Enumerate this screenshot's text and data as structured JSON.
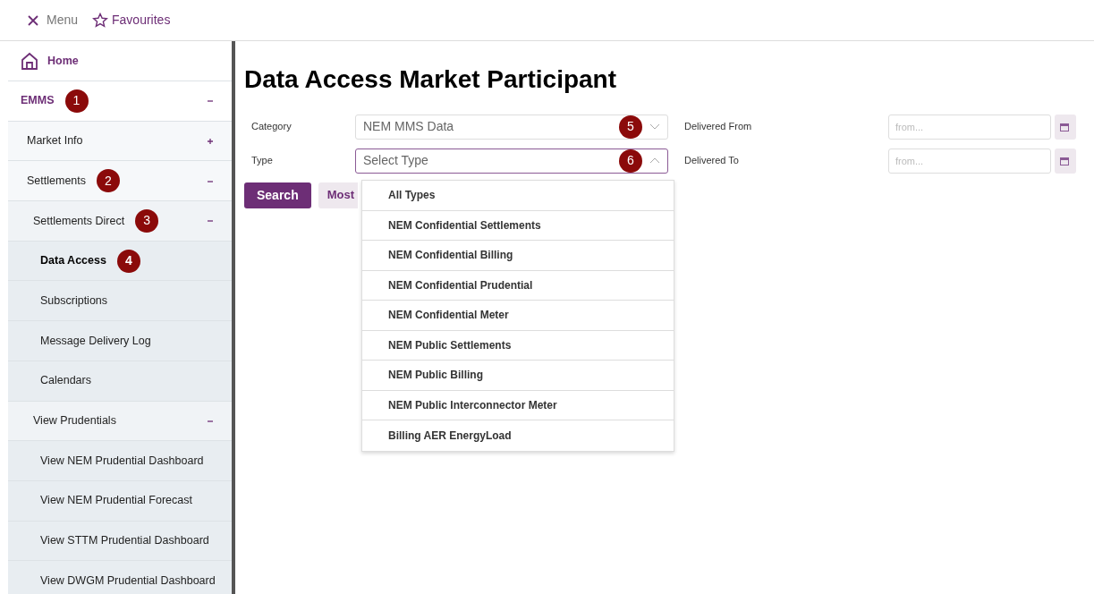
{
  "top_bar": {
    "menu": "Menu",
    "favourites": "Favourites"
  },
  "sidebar": {
    "home": "Home",
    "items": [
      {
        "label": "EMMS",
        "marker": "1",
        "expanded": true,
        "selected": false,
        "children": [
          {
            "label": "Market Info",
            "expanded": false,
            "selected": false
          },
          {
            "label": "Settlements",
            "marker": "2",
            "expanded": true,
            "selected": false,
            "children": [
              {
                "label": "Settlements Direct",
                "marker": "3",
                "expanded": true,
                "selected": false,
                "children": [
                  {
                    "label": "Data Access",
                    "marker": "4",
                    "selected": true
                  },
                  {
                    "label": "Subscriptions",
                    "selected": false
                  },
                  {
                    "label": "Message Delivery Log",
                    "selected": false
                  },
                  {
                    "label": "Calendars",
                    "selected": false
                  }
                ]
              },
              {
                "label": "View Prudentials",
                "expanded": true,
                "selected": false,
                "children": [
                  {
                    "label": "View NEM Prudential Dashboard",
                    "selected": false
                  },
                  {
                    "label": "View NEM Prudential Forecast",
                    "selected": false
                  },
                  {
                    "label": "View STTM Prudential Dashboard",
                    "selected": false
                  },
                  {
                    "label": "View DWGM Prudential Dashboard",
                    "selected": false
                  }
                ]
              }
            ]
          }
        ]
      }
    ]
  },
  "page": {
    "title": "Data Access Market Participant",
    "category": {
      "label": "Category",
      "value": "NEM MMS Data",
      "marker": "5",
      "expanded": false
    },
    "type": {
      "label": "Type",
      "placeholder": "Select Type",
      "marker": "6",
      "expanded": true,
      "options": [
        "All Types",
        "NEM Confidential Settlements",
        "NEM Confidential Billing",
        "NEM Confidential Prudential",
        "NEM Confidential Meter",
        "NEM Public Settlements",
        "NEM Public Billing",
        "NEM Public Interconnector Meter",
        "Billing AER EnergyLoad"
      ]
    },
    "delivered_from": {
      "label": "Delivered From",
      "placeholder": "from..."
    },
    "delivered_to": {
      "label": "Delivered To",
      "placeholder": "from..."
    },
    "buttons": [
      "Search",
      "Most"
    ]
  }
}
